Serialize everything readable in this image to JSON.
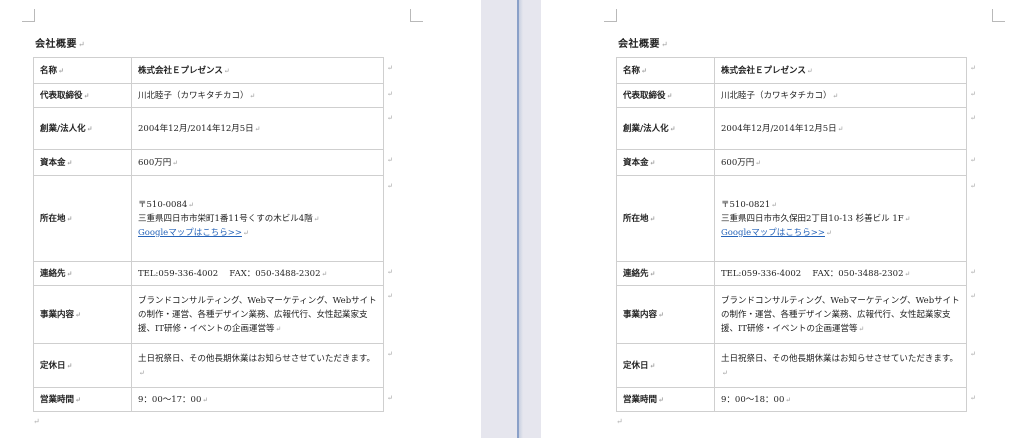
{
  "pages": [
    {
      "heading": "会社概要",
      "rows": [
        {
          "label": "名称",
          "value": [
            "株式会社Ｅプレゼンス"
          ]
        },
        {
          "label": "代表取締役",
          "value": [
            "川北睦子（カワキタチカコ）"
          ]
        },
        {
          "label": "創業/法人化",
          "value": [
            "2004年12月/2014年12月5日"
          ]
        },
        {
          "label": "資本金",
          "value": [
            "600万円"
          ]
        },
        {
          "label": "所在地",
          "value": [
            "〒510-0084",
            "三重県四日市市栄町1番11号くすの木ビル4階"
          ],
          "link": "Googleマップはこちら>>"
        },
        {
          "label": "連絡先",
          "value": [
            "TEL:059-336-4002　 FAX：050-3488-2302"
          ]
        },
        {
          "label": "事業内容",
          "value": [
            "ブランドコンサルティング、Webマーケティング、Webサイトの制作・運営、各種デザイン業務、広報代行、女性起業家支援、IT研修・イベントの企画運営等"
          ]
        },
        {
          "label": "定休日",
          "value": [
            "土日祝祭日、その他長期休業はお知らせさせていただきます。"
          ]
        },
        {
          "label": "営業時間",
          "value": [
            "9：00～17：00"
          ]
        }
      ]
    },
    {
      "heading": "会社概要",
      "rows": [
        {
          "label": "名称",
          "value": [
            "株式会社Ｅプレゼンス"
          ]
        },
        {
          "label": "代表取締役",
          "value": [
            "川北睦子（カワキタチカコ）"
          ]
        },
        {
          "label": "創業/法人化",
          "value": [
            "2004年12月/2014年12月5日"
          ]
        },
        {
          "label": "資本金",
          "value": [
            "600万円"
          ]
        },
        {
          "label": "所在地",
          "value": [
            "〒510-0821",
            "三重県四日市市久保田2丁目10-13 杉善ビル 1F"
          ],
          "link": "Googleマップはこちら>>"
        },
        {
          "label": "連絡先",
          "value": [
            "TEL:059-336-4002　 FAX：050-3488-2302"
          ]
        },
        {
          "label": "事業内容",
          "value": [
            "ブランドコンサルティング、Webマーケティング、Webサイトの制作・運営、各種デザイン業務、広報代行、女性起業家支援、IT研修・イベントの企画運営等"
          ]
        },
        {
          "label": "定休日",
          "value": [
            "土日祝祭日、その他長期休業はお知らせさせていただきます。"
          ]
        },
        {
          "label": "営業時間",
          "value": [
            "9：00～18：00"
          ]
        }
      ]
    }
  ],
  "paragraph_mark": "↵"
}
